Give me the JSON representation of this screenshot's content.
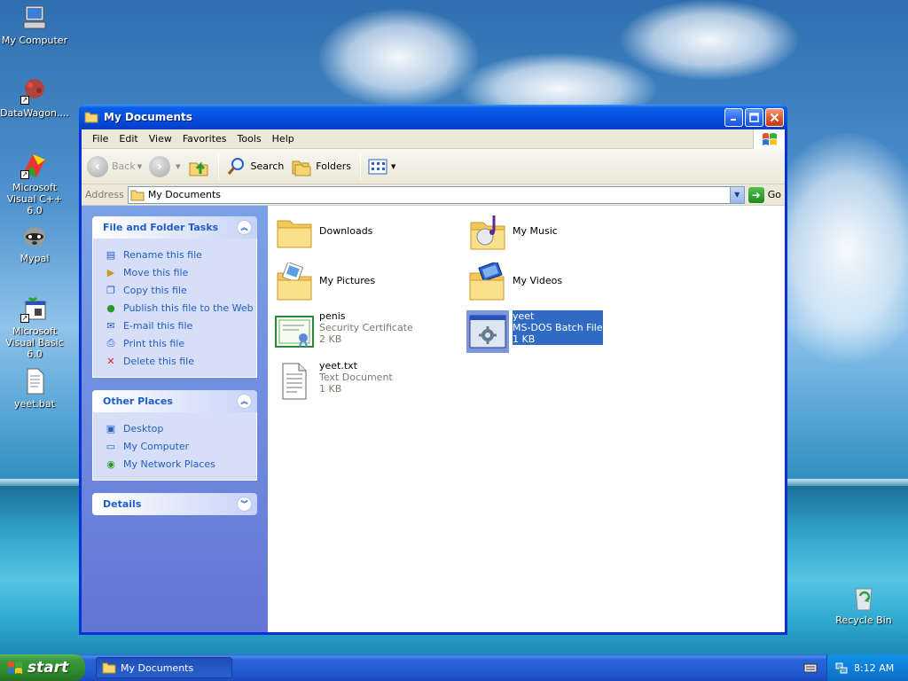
{
  "desktop": {
    "icons": [
      {
        "label": "My Computer",
        "icon": "computer-icon"
      },
      {
        "label": "DataWagon....",
        "icon": "datawagon-icon"
      },
      {
        "label": "Microsoft Visual C++ 6.0",
        "icon": "visual-cpp-icon"
      },
      {
        "label": "Mypal",
        "icon": "mypal-icon"
      },
      {
        "label": "Microsoft Visual Basic 6.0",
        "icon": "visual-basic-icon"
      },
      {
        "label": "yeet.bat",
        "icon": "batch-file-icon"
      },
      {
        "label": "Recycle Bin",
        "icon": "recycle-bin-icon"
      }
    ]
  },
  "window": {
    "title": "My Documents",
    "menu": [
      "File",
      "Edit",
      "View",
      "Favorites",
      "Tools",
      "Help"
    ],
    "toolbar": {
      "back": "Back",
      "search": "Search",
      "folders": "Folders"
    },
    "address": {
      "label": "Address",
      "value": "My Documents",
      "go": "Go"
    },
    "tasks": {
      "title": "File and Folder Tasks",
      "items": [
        "Rename this file",
        "Move this file",
        "Copy this file",
        "Publish this file to the Web",
        "E-mail this file",
        "Print this file",
        "Delete this file"
      ]
    },
    "places": {
      "title": "Other Places",
      "items": [
        "Desktop",
        "My Computer",
        "My Network Places"
      ]
    },
    "details": {
      "title": "Details"
    },
    "files": [
      {
        "name": "Downloads",
        "type": "",
        "size": "",
        "icon": "folder-icon"
      },
      {
        "name": "My Music",
        "type": "",
        "size": "",
        "icon": "music-folder-icon"
      },
      {
        "name": "My Pictures",
        "type": "",
        "size": "",
        "icon": "pictures-folder-icon"
      },
      {
        "name": "My Videos",
        "type": "",
        "size": "",
        "icon": "videos-folder-icon"
      },
      {
        "name": "penis",
        "type": "Security Certificate",
        "size": "2 KB",
        "icon": "certificate-icon"
      },
      {
        "name": "yeet",
        "type": "MS-DOS Batch File",
        "size": "1 KB",
        "icon": "batch-file-icon",
        "selected": true
      },
      {
        "name": "yeet.txt",
        "type": "Text Document",
        "size": "1 KB",
        "icon": "text-document-icon"
      }
    ]
  },
  "taskbar": {
    "start": "start",
    "task": "My Documents",
    "clock": "8:12 AM"
  }
}
